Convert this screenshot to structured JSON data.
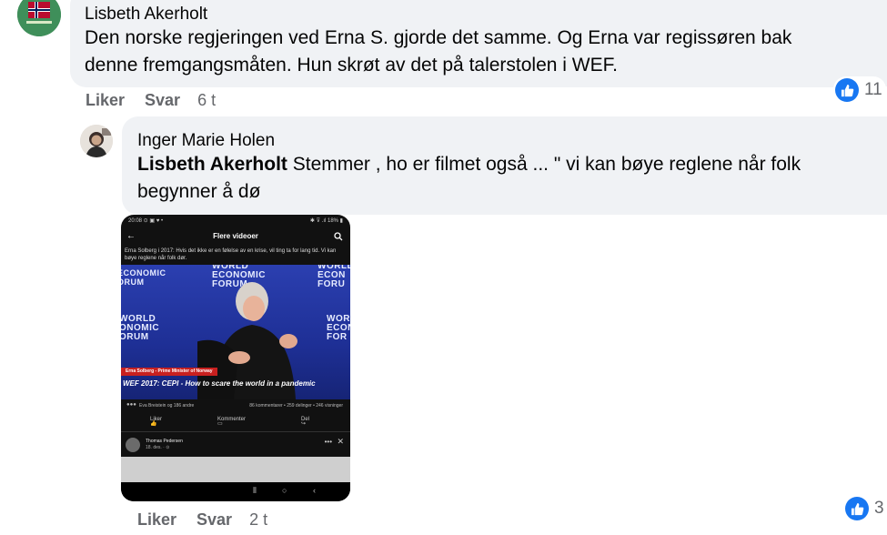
{
  "comment1": {
    "author": "Lisbeth Akerholt",
    "text": "Den norske regjeringen ved Erna S. gjorde det samme. Og Erna var regissøren bak denne fremgangsmåten. Hun skrøt av det på talerstolen i WEF.",
    "actions": {
      "like": "Liker",
      "reply": "Svar",
      "time": "6 t"
    },
    "reactions": {
      "icon": "like-icon",
      "count": "11"
    }
  },
  "reply": {
    "author": "Inger Marie Holen",
    "mention": "Lisbeth Akerholt",
    "text": " Stemmer , ho er filmet også ... \" vi kan bøye reglene når folk begynner å dø",
    "actions": {
      "like": "Liker",
      "reply": "Svar",
      "time": "2 t"
    },
    "reactions": {
      "icon": "like-icon",
      "count": "3"
    }
  },
  "phone": {
    "status_left": "20:08 ⊙ ▣ ♥ •",
    "status_right": "✱ ⊽ .ıl 18% ▮",
    "header": "Flere videoer",
    "caption": "Erna Solberg i 2017: Hvis det ikke er en følelse av en krise, vil ting ta for lang tid. Vi kan bøye reglene når folk dør.",
    "wef_top": "WORLD\nECONOMIC\nFORUM",
    "lower_name": "Erna Solberg - Prime Minister of Norway",
    "lower_title": "WEF 2017: CEPI - How to scare the world in a pandemic",
    "stats_left": "Eva Breistein og 186 andre",
    "stats_right": "86 kommentarer • 259 delinger • 246 visninger",
    "act_like": "Liker",
    "act_comment": "Kommenter",
    "act_share": "Del",
    "commenter": "Thomas Pedersen",
    "commenter_time": "18. des. · ⊙"
  },
  "colors": {
    "bubble": "#f0f2f5",
    "like_blue": "#1877f2",
    "meta": "#65676b"
  }
}
